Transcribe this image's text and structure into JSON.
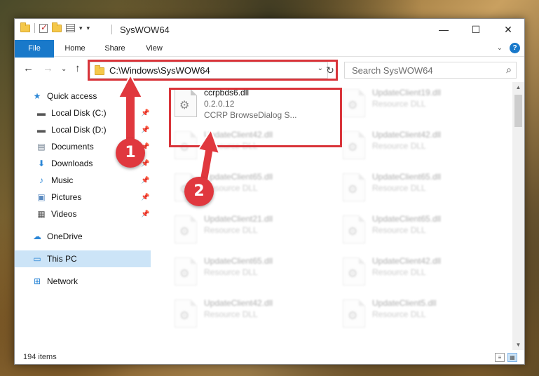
{
  "window": {
    "title": "SysWOW64"
  },
  "ribbon": {
    "tabs": [
      "File",
      "Home",
      "Share",
      "View"
    ],
    "help": "?"
  },
  "address": {
    "path": "C:\\Windows\\SysWOW64"
  },
  "search": {
    "placeholder": "Search SysWOW64"
  },
  "sidebar": {
    "quick_access": "Quick access",
    "items": [
      "Local Disk (C:)",
      "Local Disk (D:)",
      "Documents",
      "Downloads",
      "Music",
      "Pictures",
      "Videos"
    ],
    "onedrive": "OneDrive",
    "this_pc": "This PC",
    "network": "Network"
  },
  "files": {
    "main": {
      "name": "ccrpbds6.dll",
      "version": "0.2.0.12",
      "desc": "CCRP BrowseDialog S..."
    },
    "left": [
      {
        "name": "UpdateClient42.dll",
        "type": "Resource DLL"
      },
      {
        "name": "UpdateClient65.dll",
        "type": "Resource DLL"
      },
      {
        "name": "UpdateClient21.dll",
        "type": "Resource DLL"
      },
      {
        "name": "UpdateClient65.dll",
        "type": "Resource DLL"
      },
      {
        "name": "UpdateClient42.dll",
        "type": "Resource DLL"
      }
    ],
    "right": [
      {
        "name": "UpdateClient19.dll",
        "type": "Resource DLL"
      },
      {
        "name": "UpdateClient42.dll",
        "type": "Resource DLL"
      },
      {
        "name": "UpdateClient65.dll",
        "type": "Resource DLL"
      },
      {
        "name": "UpdateClient65.dll",
        "type": "Resource DLL"
      },
      {
        "name": "UpdateClient42.dll",
        "type": "Resource DLL"
      },
      {
        "name": "UpdateClient5.dll",
        "type": "Resource DLL"
      }
    ]
  },
  "status": {
    "items": "194 items"
  },
  "annotations": {
    "step1": "1",
    "step2": "2"
  },
  "colors": {
    "accent": "#1979ca",
    "highlight": "#d9343a",
    "selected": "#cce4f7"
  }
}
